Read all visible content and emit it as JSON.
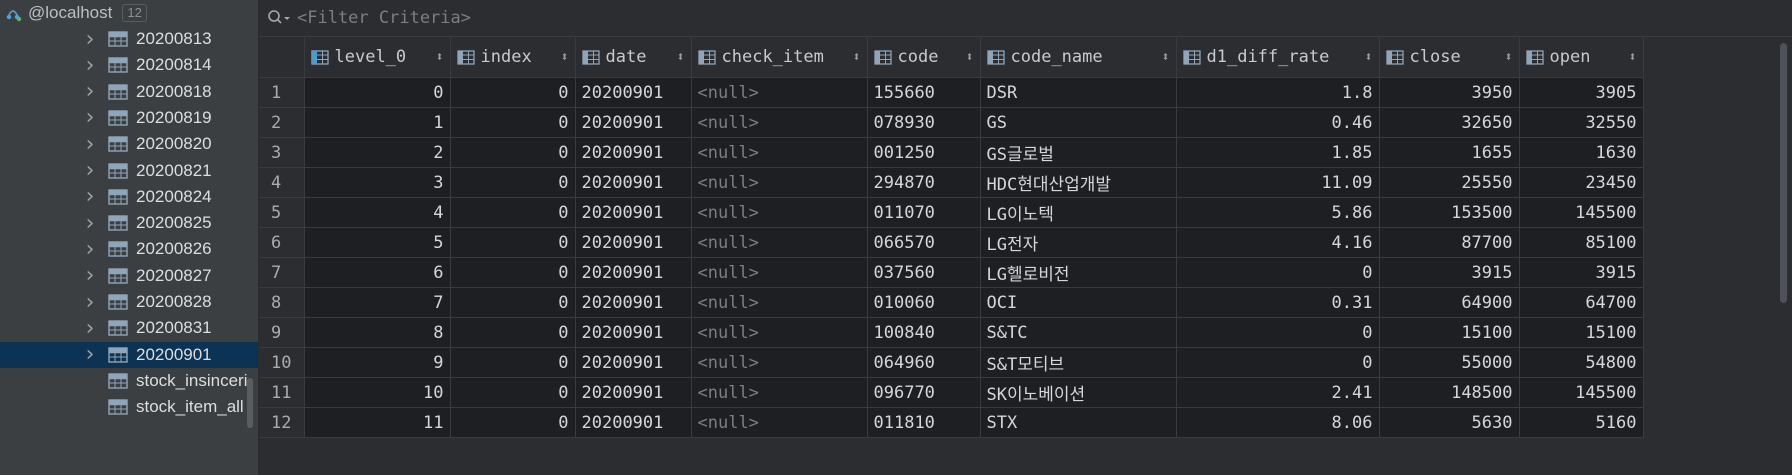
{
  "tree": {
    "host": "@localhost",
    "host_count": "12",
    "items": [
      {
        "label": "20200813",
        "expandable": true
      },
      {
        "label": "20200814",
        "expandable": true
      },
      {
        "label": "20200818",
        "expandable": true
      },
      {
        "label": "20200819",
        "expandable": true
      },
      {
        "label": "20200820",
        "expandable": true
      },
      {
        "label": "20200821",
        "expandable": true
      },
      {
        "label": "20200824",
        "expandable": true
      },
      {
        "label": "20200825",
        "expandable": true
      },
      {
        "label": "20200826",
        "expandable": true
      },
      {
        "label": "20200827",
        "expandable": true
      },
      {
        "label": "20200828",
        "expandable": true
      },
      {
        "label": "20200831",
        "expandable": true
      },
      {
        "label": "20200901",
        "expandable": true,
        "selected": true
      },
      {
        "label": "stock_insinceri",
        "expandable": false
      },
      {
        "label": "stock_item_all",
        "expandable": false
      }
    ]
  },
  "filter": {
    "placeholder": "<Filter Criteria>"
  },
  "grid": {
    "columns": [
      {
        "key": "level_0",
        "label": "level_0",
        "align": "num"
      },
      {
        "key": "index",
        "label": "index",
        "align": "num"
      },
      {
        "key": "date",
        "label": "date",
        "align": "text"
      },
      {
        "key": "check_item",
        "label": "check_item",
        "align": "text"
      },
      {
        "key": "code",
        "label": "code",
        "align": "text"
      },
      {
        "key": "code_name",
        "label": "code_name",
        "align": "text"
      },
      {
        "key": "d1_diff_rate",
        "label": "d1_diff_rate",
        "align": "num"
      },
      {
        "key": "close",
        "label": "close",
        "align": "num"
      },
      {
        "key": "open",
        "label": "open",
        "align": "num"
      }
    ],
    "null_text": "<null>",
    "rows": [
      {
        "n": "1",
        "level_0": "0",
        "index": "0",
        "date": "20200901",
        "check_item": null,
        "code": "155660",
        "code_name": "DSR",
        "d1_diff_rate": "1.8",
        "close": "3950",
        "open": "3905"
      },
      {
        "n": "2",
        "level_0": "1",
        "index": "0",
        "date": "20200901",
        "check_item": null,
        "code": "078930",
        "code_name": "GS",
        "d1_diff_rate": "0.46",
        "close": "32650",
        "open": "32550"
      },
      {
        "n": "3",
        "level_0": "2",
        "index": "0",
        "date": "20200901",
        "check_item": null,
        "code": "001250",
        "code_name": "GS글로벌",
        "d1_diff_rate": "1.85",
        "close": "1655",
        "open": "1630"
      },
      {
        "n": "4",
        "level_0": "3",
        "index": "0",
        "date": "20200901",
        "check_item": null,
        "code": "294870",
        "code_name": "HDC현대산업개발",
        "d1_diff_rate": "11.09",
        "close": "25550",
        "open": "23450"
      },
      {
        "n": "5",
        "level_0": "4",
        "index": "0",
        "date": "20200901",
        "check_item": null,
        "code": "011070",
        "code_name": "LG이노텍",
        "d1_diff_rate": "5.86",
        "close": "153500",
        "open": "145500"
      },
      {
        "n": "6",
        "level_0": "5",
        "index": "0",
        "date": "20200901",
        "check_item": null,
        "code": "066570",
        "code_name": "LG전자",
        "d1_diff_rate": "4.16",
        "close": "87700",
        "open": "85100"
      },
      {
        "n": "7",
        "level_0": "6",
        "index": "0",
        "date": "20200901",
        "check_item": null,
        "code": "037560",
        "code_name": "LG헬로비전",
        "d1_diff_rate": "0",
        "close": "3915",
        "open": "3915"
      },
      {
        "n": "8",
        "level_0": "7",
        "index": "0",
        "date": "20200901",
        "check_item": null,
        "code": "010060",
        "code_name": "OCI",
        "d1_diff_rate": "0.31",
        "close": "64900",
        "open": "64700"
      },
      {
        "n": "9",
        "level_0": "8",
        "index": "0",
        "date": "20200901",
        "check_item": null,
        "code": "100840",
        "code_name": "S&TC",
        "d1_diff_rate": "0",
        "close": "15100",
        "open": "15100"
      },
      {
        "n": "10",
        "level_0": "9",
        "index": "0",
        "date": "20200901",
        "check_item": null,
        "code": "064960",
        "code_name": "S&T모티브",
        "d1_diff_rate": "0",
        "close": "55000",
        "open": "54800"
      },
      {
        "n": "11",
        "level_0": "10",
        "index": "0",
        "date": "20200901",
        "check_item": null,
        "code": "096770",
        "code_name": "SK이노베이션",
        "d1_diff_rate": "2.41",
        "close": "148500",
        "open": "145500"
      },
      {
        "n": "12",
        "level_0": "11",
        "index": "0",
        "date": "20200901",
        "check_item": null,
        "code": "011810",
        "code_name": "STX",
        "d1_diff_rate": "8.06",
        "close": "5630",
        "open": "5160"
      }
    ]
  },
  "colors": {
    "selection": "#0d3354",
    "table_icon": "#8fa5b9",
    "key_icon": "#4a9ad4"
  }
}
